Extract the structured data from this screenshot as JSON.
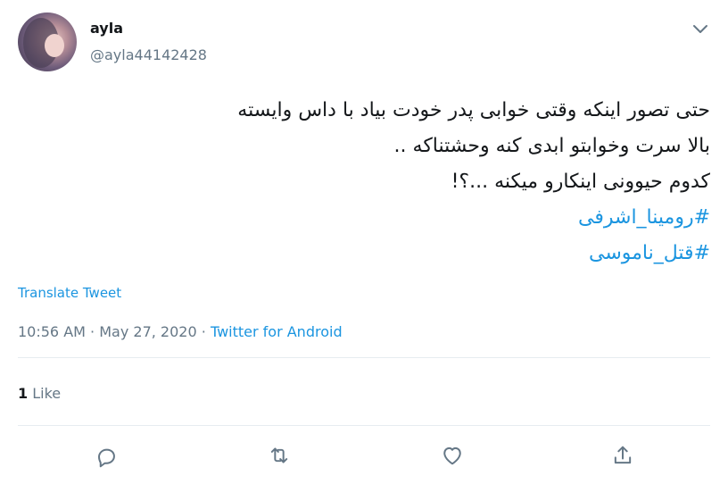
{
  "user": {
    "display_name": "ayla",
    "handle": "@ayla44142428"
  },
  "tweet": {
    "lines": [
      "حتی تصور اینکه وقتی خوابی پدر خودت بیاد با داس وایسته",
      "بالا سرت وخوابتو ابدی کنه وحشتناکه ..",
      "کدوم حیوونی اینکارو میکنه ...؟!"
    ],
    "hashtags": [
      "#رومینا_اشرفی",
      "#قتل_ناموسی"
    ]
  },
  "translate_label": "Translate Tweet",
  "meta": {
    "time": "10:56 AM",
    "separator": "·",
    "date": "May 27, 2020",
    "source": "Twitter for Android"
  },
  "stats": {
    "like_count": "1",
    "like_label": "Like"
  },
  "icons": {
    "caret": "chevron-down-icon",
    "reply": "reply-icon",
    "retweet": "retweet-icon",
    "like": "heart-icon",
    "share": "share-icon"
  },
  "colors": {
    "link": "#1b95e0",
    "muted": "#657786",
    "text": "#14171a",
    "divider": "#e6ecf0"
  }
}
